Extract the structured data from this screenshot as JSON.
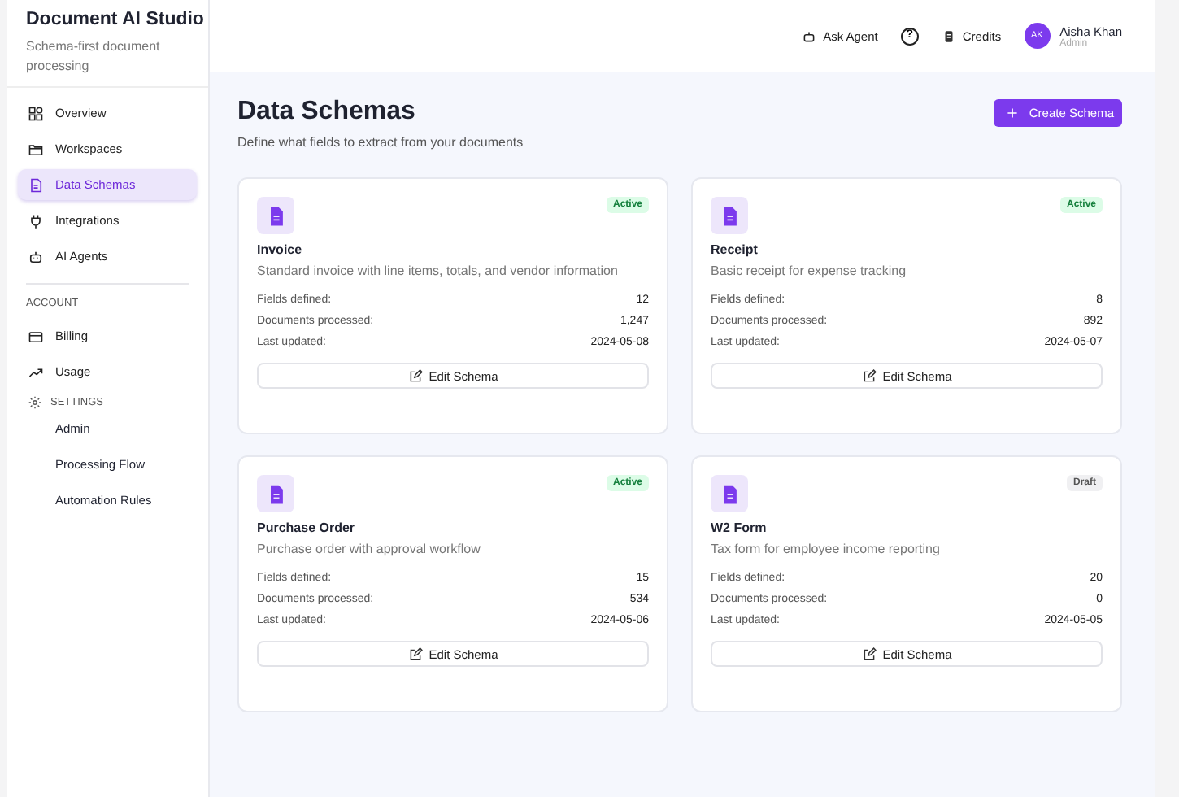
{
  "sidebar": {
    "title": "Document AI Studio",
    "subtitle": "Schema-first document processing",
    "items": [
      {
        "label": "Overview",
        "kind": "grid",
        "selected": false
      },
      {
        "label": "Workspaces",
        "kind": "folder",
        "selected": false
      },
      {
        "label": "Data Schemas",
        "kind": "doc",
        "selected": true
      },
      {
        "label": "Integrations",
        "kind": "plug",
        "selected": false
      },
      {
        "label": "AI Agents",
        "kind": "bot",
        "selected": false
      }
    ],
    "account_heading": "ACCOUNT",
    "account_items": [
      {
        "label": "Billing",
        "kind": "card"
      },
      {
        "label": "Usage",
        "kind": "trend"
      }
    ],
    "settings": {
      "label": "SETTINGS",
      "children": [
        {
          "label": "Admin"
        },
        {
          "label": "Processing Flow"
        },
        {
          "label": "Automation Rules"
        }
      ]
    }
  },
  "header": {
    "ask_agent": "Ask Agent",
    "help": "?",
    "credits": "Credits",
    "user": {
      "initials": "AK",
      "name": "Aisha Khan",
      "role": "Admin"
    }
  },
  "page": {
    "title": "Data Schemas",
    "subtitle": "Define what fields to extract from your documents",
    "create_button": "Create Schema"
  },
  "cards": [
    {
      "name": "Invoice",
      "description": "Standard invoice with line items, totals, and vendor information",
      "status": "Active",
      "kind": "active",
      "stats": [
        {
          "label": "Fields defined:",
          "value": "12"
        },
        {
          "label": "Documents processed:",
          "value": "1,247"
        },
        {
          "label": "Last updated:",
          "value": "2024-05-08"
        }
      ],
      "button": "Edit Schema"
    },
    {
      "name": "Receipt",
      "description": "Basic receipt for expense tracking",
      "status": "Active",
      "kind": "active",
      "stats": [
        {
          "label": "Fields defined:",
          "value": "8"
        },
        {
          "label": "Documents processed:",
          "value": "892"
        },
        {
          "label": "Last updated:",
          "value": "2024-05-07"
        }
      ],
      "button": "Edit Schema"
    },
    {
      "name": "Purchase Order",
      "description": "Purchase order with approval workflow",
      "status": "Active",
      "kind": "active",
      "stats": [
        {
          "label": "Fields defined:",
          "value": "15"
        },
        {
          "label": "Documents processed:",
          "value": "534"
        },
        {
          "label": "Last updated:",
          "value": "2024-05-06"
        }
      ],
      "button": "Edit Schema"
    },
    {
      "name": "W2 Form",
      "description": "Tax form for employee income reporting",
      "status": "Draft",
      "kind": "draft",
      "stats": [
        {
          "label": "Fields defined:",
          "value": "20"
        },
        {
          "label": "Documents processed:",
          "value": "0"
        },
        {
          "label": "Last updated:",
          "value": "2024-05-05"
        }
      ],
      "button": "Edit Schema"
    }
  ]
}
